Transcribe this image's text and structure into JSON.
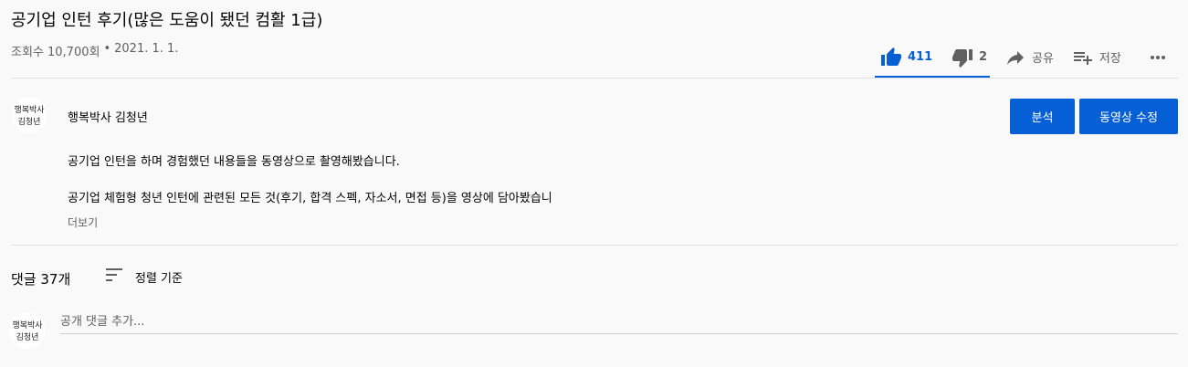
{
  "video": {
    "title": "공기업 인턴 후기(많은 도움이 됐던 컴활 1급)",
    "views": "조회수 10,700회",
    "separator": "•",
    "date": "2021. 1. 1."
  },
  "actions": {
    "like_count": "411",
    "dislike_count": "2",
    "share_label": "공유",
    "save_label": "저장"
  },
  "channel": {
    "name": "행복박사 김청년",
    "avatar_text_line1": "행복박사",
    "avatar_text_line2": "김청년"
  },
  "buttons": {
    "analyze": "분석",
    "edit": "동영상 수정"
  },
  "description": {
    "line1": "공기업 인턴을 하며 경험했던 내용들을 동영상으로 촬영해봤습니다.",
    "line2": "공기업 체험형 청년 인턴에 관련된 모든 것(후기, 합격 스펙, 자소서, 면접 등)을 영상에 담아봤습니",
    "more_label": "더보기"
  },
  "comments": {
    "count_label": "댓글 37개",
    "sort_label": "정렬 기준",
    "input_placeholder": "공개 댓글 추가..."
  },
  "colors": {
    "accent": "#065fd4",
    "text_secondary": "#606060",
    "background": "#f9f9f9"
  },
  "icons": {
    "like": "thumbs-up-icon",
    "dislike": "thumbs-down-icon",
    "share": "share-arrow-icon",
    "save": "playlist-add-icon",
    "more": "more-horizontal-icon",
    "sort": "sort-icon"
  }
}
